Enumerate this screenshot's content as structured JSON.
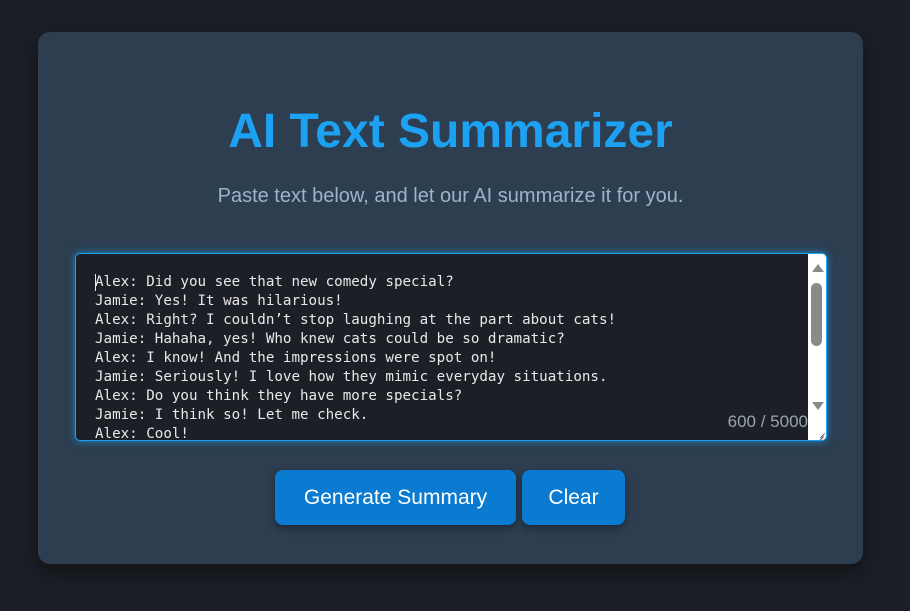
{
  "header": {
    "title": "AI Text Summarizer",
    "subtitle": "Paste text below, and let our AI summarize it for you."
  },
  "input": {
    "value": "Alex: Did you see that new comedy special?\nJamie: Yes! It was hilarious!\nAlex: Right? I couldn’t stop laughing at the part about cats!\nJamie: Hahaha, yes! Who knew cats could be so dramatic?\nAlex: I know! And the impressions were spot on!\nJamie: Seriously! I love how they mimic everyday situations.\nAlex: Do you think they have more specials?\nJamie: I think so! Let me check.\nAlex: Cool!",
    "char_count": "600 / 5000"
  },
  "actions": {
    "generate_label": "Generate Summary",
    "clear_label": "Clear"
  },
  "colors": {
    "page_background": "#1c1f26",
    "card_background": "#2c3e50",
    "accent": "#1da1f2",
    "button": "#0a7bd0"
  },
  "icons": {
    "scroll_up": "scroll-up-arrow-icon",
    "scroll_down": "scroll-down-arrow-icon",
    "resize": "resize-grip-icon"
  }
}
